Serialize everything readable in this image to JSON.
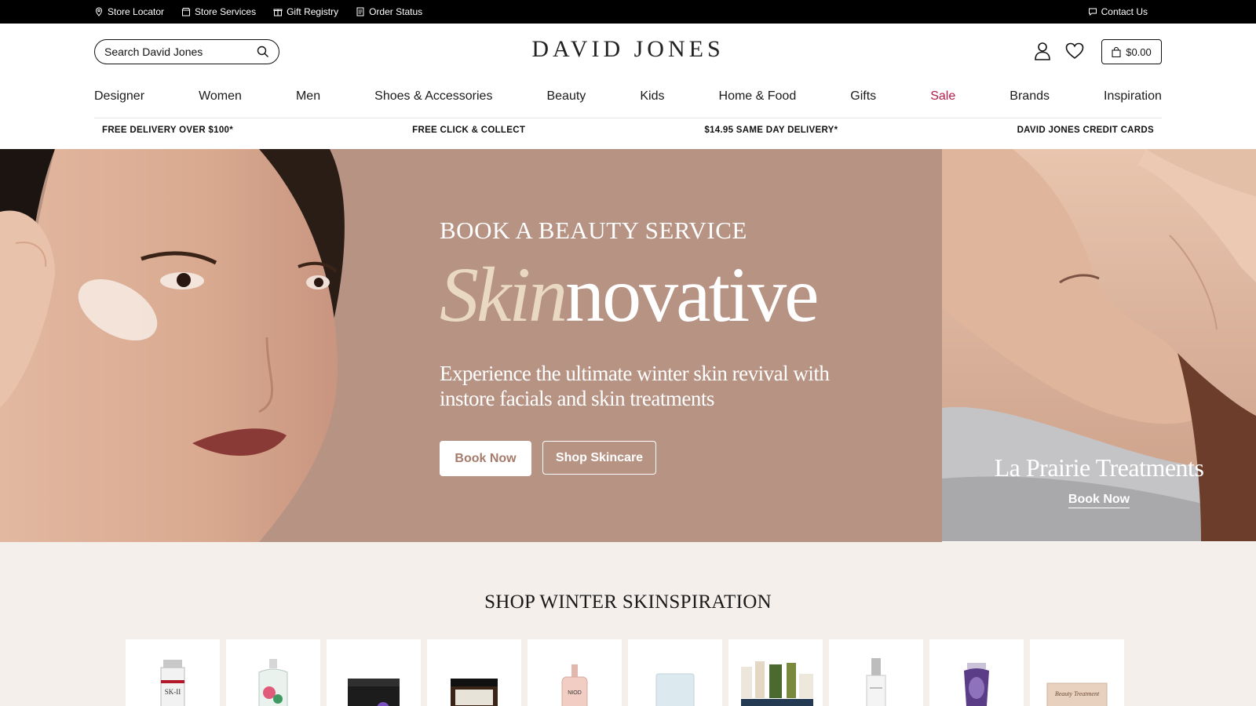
{
  "utility_bar": {
    "store_locator": "Store Locator",
    "store_services": "Store Services",
    "gift_registry": "Gift Registry",
    "order_status": "Order Status",
    "contact_us": "Contact Us"
  },
  "header": {
    "search_placeholder": "Search David Jones",
    "logo": "DAVID JONES",
    "cart_total": "$0.00"
  },
  "nav": {
    "items": [
      {
        "label": "Designer"
      },
      {
        "label": "Women"
      },
      {
        "label": "Men"
      },
      {
        "label": "Shoes & Accessories"
      },
      {
        "label": "Beauty"
      },
      {
        "label": "Kids"
      },
      {
        "label": "Home & Food"
      },
      {
        "label": "Gifts"
      },
      {
        "label": "Sale"
      },
      {
        "label": "Brands"
      },
      {
        "label": "Inspiration"
      }
    ]
  },
  "promo": {
    "items": [
      {
        "label": "FREE DELIVERY OVER $100*"
      },
      {
        "label": "FREE CLICK & COLLECT"
      },
      {
        "label": "$14.95 SAME DAY DELIVERY*"
      },
      {
        "label": "DAVID JONES CREDIT CARDS"
      }
    ]
  },
  "hero": {
    "eyebrow": "BOOK A BEAUTY SERVICE",
    "title_part1": "Skin",
    "title_part2": "novative",
    "subtitle": "Experience the ultimate winter skin revival with instore facials and skin treatments",
    "primary_button": "Book Now",
    "secondary_button": "Shop Skincare"
  },
  "side_panel": {
    "title": "La Prairie Treatments",
    "link": "Book Now"
  },
  "skinspiration": {
    "title": "SHOP WINTER SKINSPIRATION",
    "tiles": [
      {
        "label": "SK-II"
      },
      {
        "label": ""
      },
      {
        "label": ""
      },
      {
        "label": ""
      },
      {
        "label": "NIOD"
      },
      {
        "label": ""
      },
      {
        "label": ""
      },
      {
        "label": ""
      },
      {
        "label": ""
      },
      {
        "label": "Beauty Treatment"
      }
    ]
  },
  "colors": {
    "hero_bg": "#b79384",
    "sale_red": "#b31b48",
    "lower_bg": "#f5efec",
    "topbar_bg": "#000000"
  }
}
